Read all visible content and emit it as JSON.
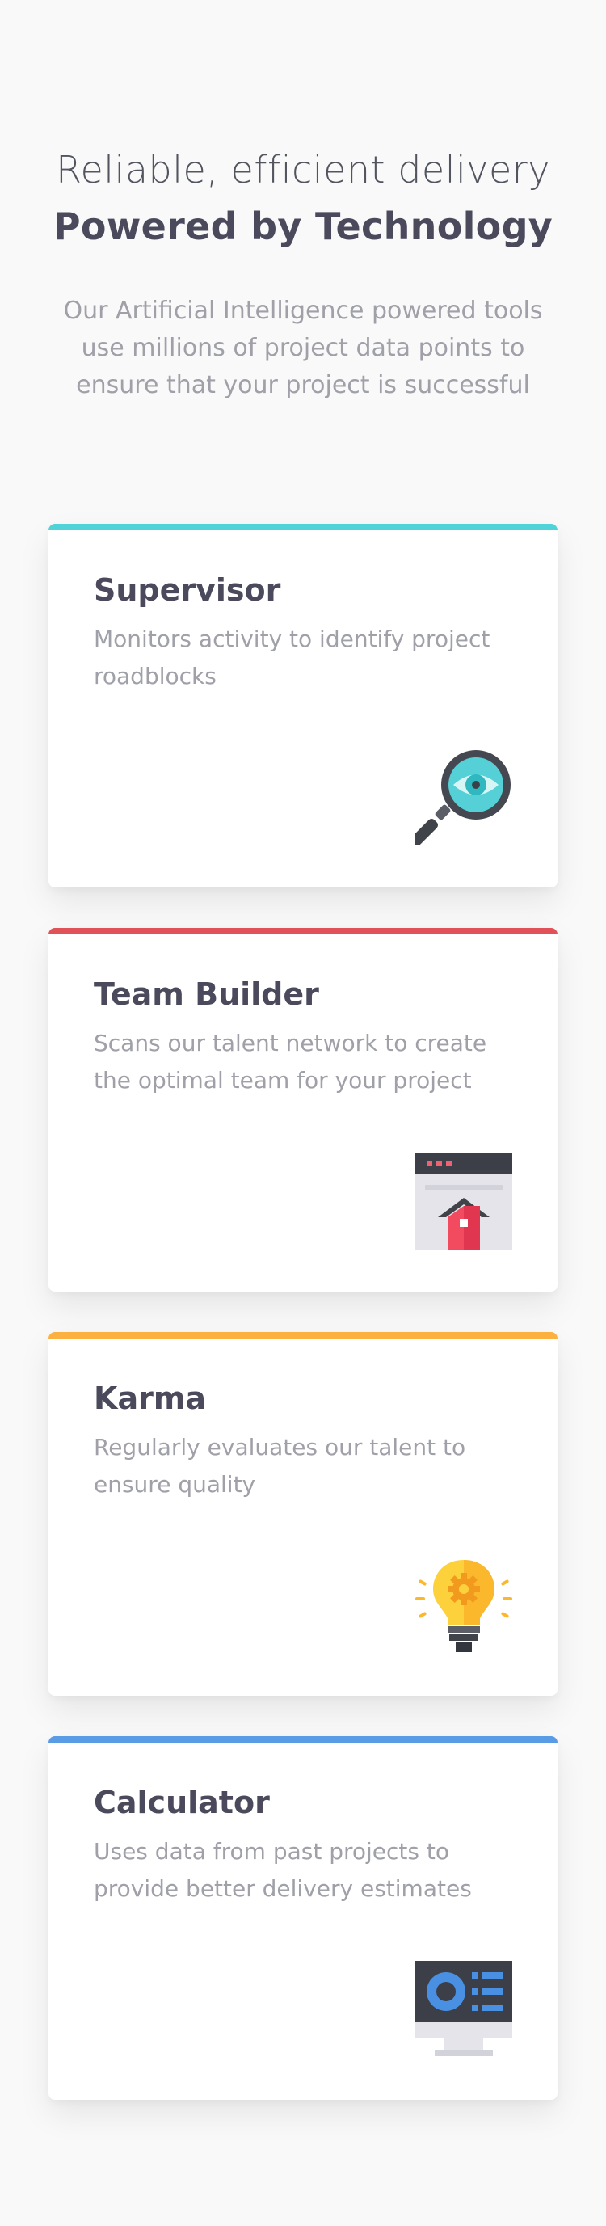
{
  "hero": {
    "line1": "Reliable, efficient delivery",
    "line2": "Powered by Technology",
    "description": "Our Artificial Intelligence powered tools use millions of project data points to ensure that your project is successful"
  },
  "cards": [
    {
      "title": "Supervisor",
      "description": "Monitors activity to identify project roadblocks",
      "accent": "#4fd3d9",
      "icon": "magnifier-eye-icon"
    },
    {
      "title": "Team Builder",
      "description": "Scans our talent network to create the optimal team for your project",
      "accent": "#e05258",
      "icon": "browser-house-icon"
    },
    {
      "title": "Karma",
      "description": "Regularly evaluates our talent to ensure quality",
      "accent": "#fbb040",
      "icon": "lightbulb-gear-icon"
    },
    {
      "title": "Calculator",
      "description": "Uses data from past projects to provide better delivery estimates",
      "accent": "#5a9be6",
      "icon": "monitor-chart-icon"
    }
  ]
}
